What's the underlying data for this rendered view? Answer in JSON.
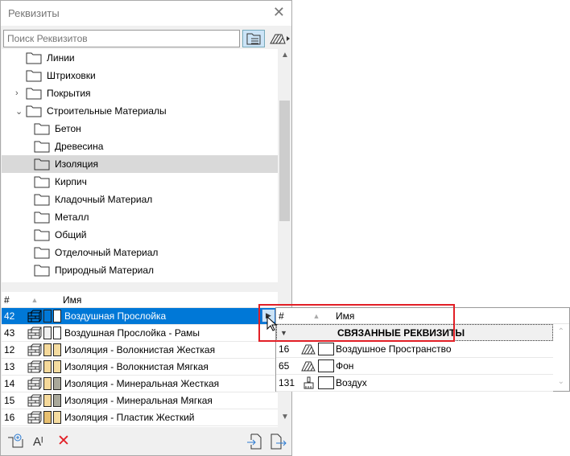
{
  "window": {
    "title": "Реквизиты",
    "close_icon": "close-icon"
  },
  "search": {
    "placeholder": "Поиск Реквизитов"
  },
  "tree": [
    {
      "label": "Линии",
      "level": 1,
      "icon": "folder-lines-icon"
    },
    {
      "label": "Штриховки",
      "level": 1,
      "icon": "folder-fills-icon"
    },
    {
      "label": "Покрытия",
      "level": 1,
      "icon": "folder-surfaces-icon",
      "expand": "collapsed"
    },
    {
      "label": "Строительные Материалы",
      "level": 1,
      "icon": "folder-materials-icon",
      "expand": "expanded"
    },
    {
      "label": "Бетон",
      "level": 2,
      "icon": "folder-icon"
    },
    {
      "label": "Древесина",
      "level": 2,
      "icon": "folder-icon"
    },
    {
      "label": "Изоляция",
      "level": 2,
      "icon": "folder-icon",
      "selected": true
    },
    {
      "label": "Кирпич",
      "level": 2,
      "icon": "folder-icon"
    },
    {
      "label": "Кладочный Материал",
      "level": 2,
      "icon": "folder-icon"
    },
    {
      "label": "Металл",
      "level": 2,
      "icon": "folder-icon"
    },
    {
      "label": "Общий",
      "level": 2,
      "icon": "folder-icon"
    },
    {
      "label": "Отделочный Материал",
      "level": 2,
      "icon": "folder-icon"
    },
    {
      "label": "Природный Материал",
      "level": 2,
      "icon": "folder-icon"
    }
  ],
  "list": {
    "headers": {
      "num": "#",
      "name": "Имя"
    },
    "rows": [
      {
        "num": "42",
        "name": "Воздушная Прослойка",
        "c1": "#ffffff",
        "c2": "#ffffff",
        "selected": true
      },
      {
        "num": "43",
        "name": "Воздушная Прослойка - Рамы",
        "c1": "#f0f0f0",
        "c2": "#ffffff"
      },
      {
        "num": "12",
        "name": "Изоляция - Волокнистая Жесткая",
        "c1": "#f5d99a",
        "c2": "#f5dca0"
      },
      {
        "num": "13",
        "name": "Изоляция - Волокнистая Мягкая",
        "c1": "#f5d99a",
        "c2": "#f5dca0"
      },
      {
        "num": "14",
        "name": "Изоляция - Минеральная Жесткая",
        "c1": "#f5d99a",
        "c2": "#a9a89a"
      },
      {
        "num": "15",
        "name": "Изоляция - Минеральная Мягкая",
        "c1": "#f5d99a",
        "c2": "#a9a89a"
      },
      {
        "num": "16",
        "name": "Изоляция - Пластик Жесткий",
        "c1": "#e8c070",
        "c2": "#f5dca0"
      }
    ]
  },
  "popup": {
    "headers": {
      "num": "#",
      "name": "Имя"
    },
    "group": "СВЯЗАННЫЕ РЕКВИЗИТЫ",
    "rows": [
      {
        "num": "16",
        "name": "Воздушное Пространство",
        "icon": "fill-hatch-icon"
      },
      {
        "num": "65",
        "name": "Фон",
        "icon": "fill-hatch-icon"
      },
      {
        "num": "131",
        "name": "Воздух",
        "icon": "brush-icon"
      }
    ]
  },
  "colors": {
    "selection": "#0078d7",
    "highlight": "#e21f26",
    "delete": "#e21f26",
    "accent": "#2b7ad0"
  }
}
